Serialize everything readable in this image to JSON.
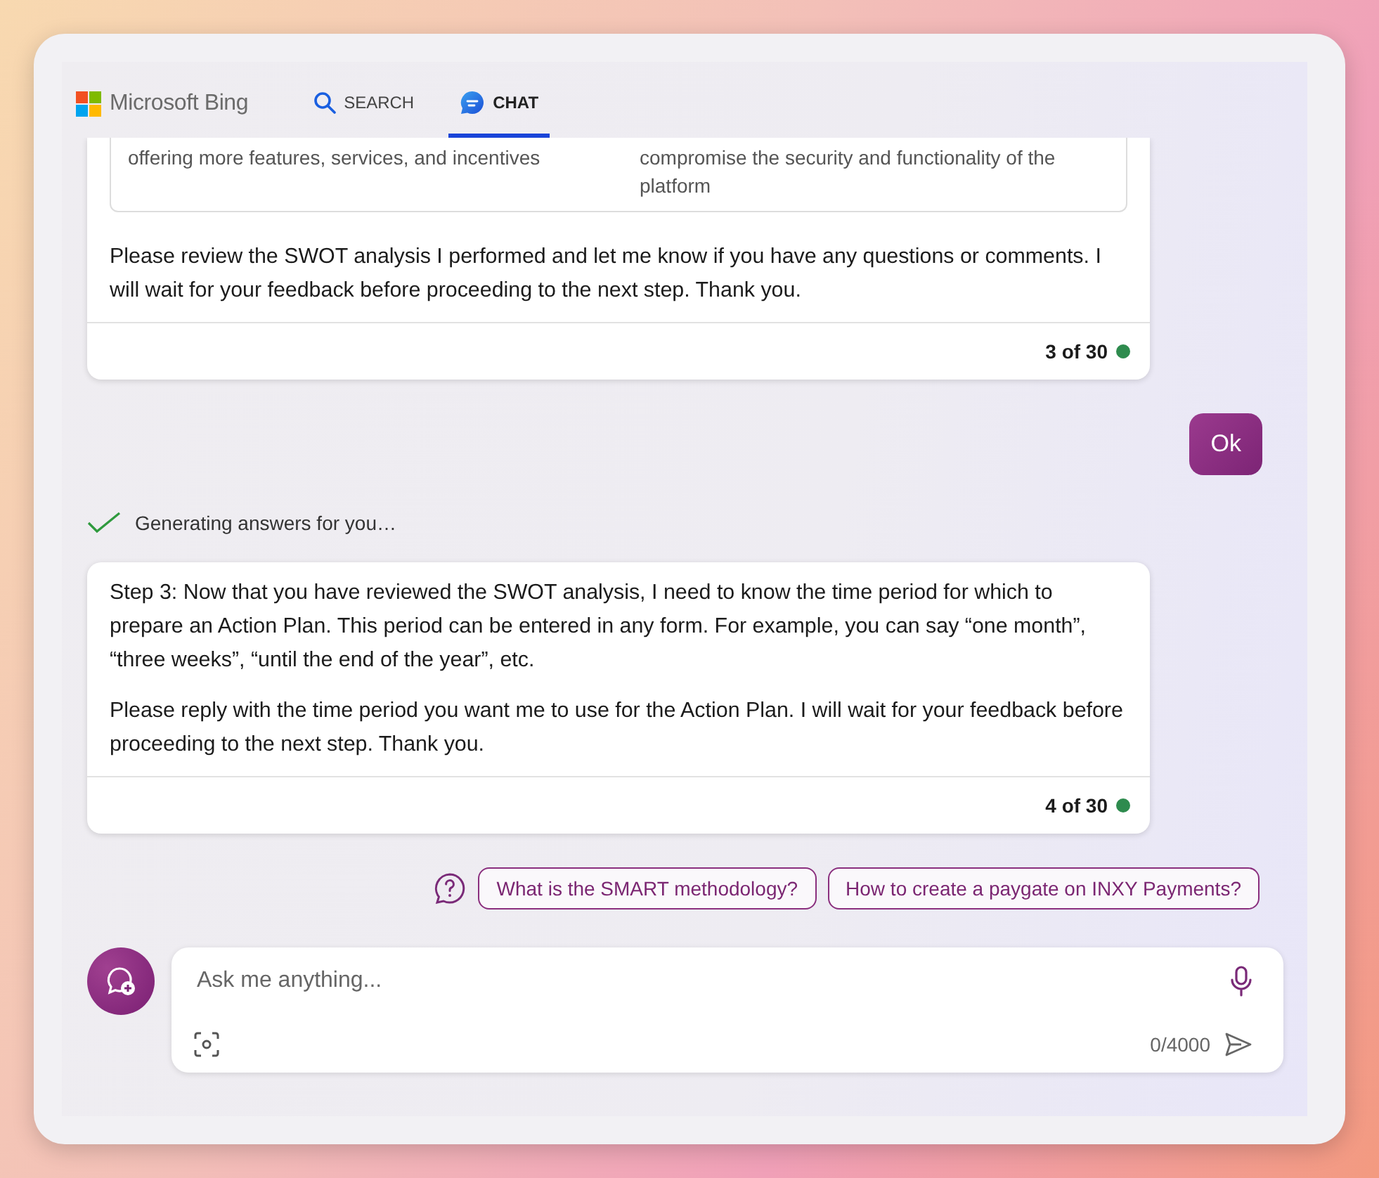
{
  "header": {
    "brand": "Microsoft Bing",
    "tabs": [
      {
        "label": "SEARCH",
        "kind": "search",
        "selected": false
      },
      {
        "label": "CHAT",
        "kind": "chat",
        "selected": true
      }
    ]
  },
  "messages": [
    {
      "kind": "bot",
      "table_cells": [
        "offering more features, services, and incentives",
        "compromise the security and functionality of the platform"
      ],
      "paragraphs": [
        "Please review the SWOT analysis I performed and let me know if you have any questions or comments. I will wait for your feedback before proceeding to the next step. Thank you."
      ],
      "counter": "3 of 30",
      "color": "#2e8b4e"
    },
    {
      "kind": "user",
      "text": "Ok"
    },
    {
      "kind": "status",
      "text": "Generating answers for you…",
      "done": true
    },
    {
      "kind": "bot",
      "paragraphs": [
        "Step 3: Now that you have reviewed the SWOT analysis, I need to know the time period for which to prepare an Action Plan. This period can be entered in any form. For example, you can say “one month”, “three weeks”, “until the end of the year”, etc.",
        "Please reply with the time period you want me to use for the Action Plan. I will wait for your feedback before proceeding to the next step. Thank you."
      ],
      "counter": "4 of 30",
      "color": "#2e8b4e"
    }
  ],
  "suggestions": [
    "What is the SMART methodology?",
    "How to create a paygate on INXY Payments?"
  ],
  "composer": {
    "placeholder": "Ask me anything...",
    "char_count": "0/4000"
  }
}
